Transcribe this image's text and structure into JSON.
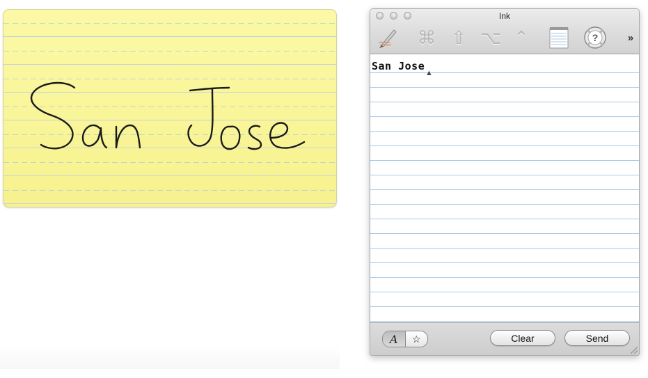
{
  "ink_pad": {
    "strokes_label": "San Jose",
    "paper_color": "#f9f59a",
    "ink_color": "#1a1a1a"
  },
  "window": {
    "title": "Ink",
    "toolbar": {
      "items": [
        {
          "name": "pen-tool-icon",
          "glyph": ""
        },
        {
          "name": "command-key-icon",
          "glyph": "⌘"
        },
        {
          "name": "shift-key-icon",
          "glyph": "⇧"
        },
        {
          "name": "option-key-icon",
          "glyph": "⌥"
        },
        {
          "name": "control-key-icon",
          "glyph": "⌃"
        },
        {
          "name": "notepad-icon",
          "glyph": ""
        },
        {
          "name": "help-icon",
          "glyph": ""
        }
      ],
      "overflow_glyph": "»"
    },
    "notepad": {
      "recognized_text": "San Jose",
      "line_color": "#a9c9e4"
    },
    "bottombar": {
      "mode_write_glyph": "A",
      "mode_gesture_glyph": "☆",
      "clear_label": "Clear",
      "send_label": "Send"
    }
  }
}
